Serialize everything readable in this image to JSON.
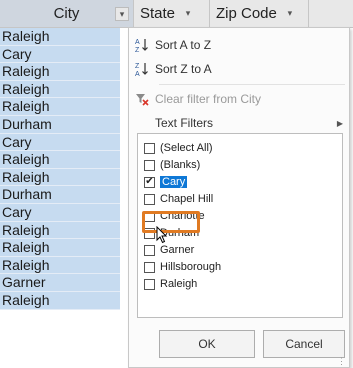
{
  "header": {
    "city": "City",
    "state": "State",
    "zip": "Zip Code",
    "dropdown_glyph": "▾"
  },
  "rows": [
    "Raleigh",
    "Cary",
    "Raleigh",
    "Raleigh",
    "Raleigh",
    "Durham",
    "Cary",
    "Raleigh",
    "Raleigh",
    "Durham",
    "Cary",
    "Raleigh",
    "Raleigh",
    "Raleigh",
    "Garner",
    "Raleigh"
  ],
  "menu": {
    "sort_az": "Sort A to Z",
    "sort_za": "Sort Z to A",
    "clear_filter": "Clear filter from City",
    "text_filters": "Text Filters",
    "submenu_arrow": "▶",
    "ok": "OK",
    "cancel": "Cancel"
  },
  "filter_list": [
    {
      "label": "(Select All)",
      "checked": false
    },
    {
      "label": "(Blanks)",
      "checked": false
    },
    {
      "label": "Cary",
      "checked": true
    },
    {
      "label": "Chapel Hill",
      "checked": false
    },
    {
      "label": "Charlotte",
      "checked": false
    },
    {
      "label": "Durham",
      "checked": false
    },
    {
      "label": "Garner",
      "checked": false
    },
    {
      "label": "Hillsborough",
      "checked": false
    },
    {
      "label": "Raleigh",
      "checked": false
    }
  ],
  "colors": {
    "selected_column": "#c6dbf0",
    "highlight_border": "#e07a22",
    "selection_blue": "#0e78d6"
  },
  "icons": {
    "sort_az": "sort-ascending-icon",
    "sort_za": "sort-descending-icon",
    "clear_filter": "clear-filter-icon",
    "cursor": "mouse-pointer-icon"
  }
}
